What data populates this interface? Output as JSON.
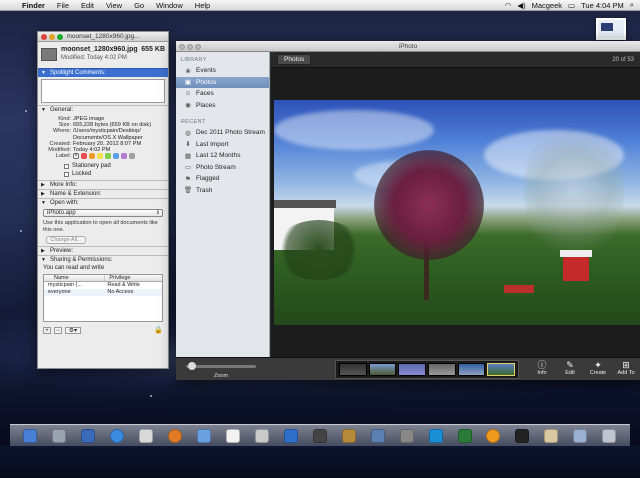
{
  "menubar": {
    "apple": "",
    "items": [
      "Finder",
      "File",
      "Edit",
      "View",
      "Go",
      "Window",
      "Help"
    ],
    "clock": "Tue 4:04 PM",
    "user": "Macgeek"
  },
  "info_window": {
    "title": "moonset_1280x960.jpg...",
    "filename": "moonset_1280x960.jpg",
    "size_short": "655 KB",
    "modified": "Modified: Today 4:02 PM",
    "spotlight_header": "Spotlight Comments:",
    "general_header": "General:",
    "general": [
      {
        "k": "Kind:",
        "v": "JPEG image"
      },
      {
        "k": "Size:",
        "v": "655,228 bytes (659 KB on disk)"
      },
      {
        "k": "Where:",
        "v": "/Users/mysticpain/Desktop/ Documents/OS X Wallpaper"
      },
      {
        "k": "Created:",
        "v": "February 20, 2012 8:07 PM"
      },
      {
        "k": "Modified:",
        "v": "Today 4:02 PM"
      },
      {
        "k": "Label:",
        "v": ""
      }
    ],
    "stationery": "Stationery pad",
    "locked": "Locked",
    "more_info": "More Info:",
    "name_ext": "Name & Extension:",
    "open_with": "Open with:",
    "app": "iPhoto.app",
    "open_note": "Use this application to open all documents like this one.",
    "change_all": "Change All...",
    "preview": "Preview:",
    "sharing": "Sharing & Permissions:",
    "perm_note": "You can read and write",
    "perm_cols": [
      "Name",
      "Privilege"
    ],
    "perm_rows": [
      {
        "name": "mysticpain (...",
        "priv": "Read & Write"
      },
      {
        "name": "everyone",
        "priv": "No Access"
      }
    ],
    "label_colors": [
      "#e84b4b",
      "#f0a030",
      "#f3e04a",
      "#7fce4a",
      "#5aa0e8",
      "#b37ad6",
      "#a0a0a0"
    ]
  },
  "iphoto": {
    "title": "iPhoto",
    "library_hdr": "LIBRARY",
    "library": [
      "Events",
      "Photos",
      "Faces",
      "Places"
    ],
    "recent_hdr": "RECENT",
    "recent": [
      "Dec 2011 Photo Stream",
      "Last Import",
      "Last 12 Months",
      "Photo Stream",
      "Flagged",
      "Trash"
    ],
    "photos_btn": "Photos",
    "count": "20 of 53",
    "zoom": "Zoom",
    "tools": [
      "Info",
      "Edit",
      "Create",
      "Add To"
    ]
  }
}
